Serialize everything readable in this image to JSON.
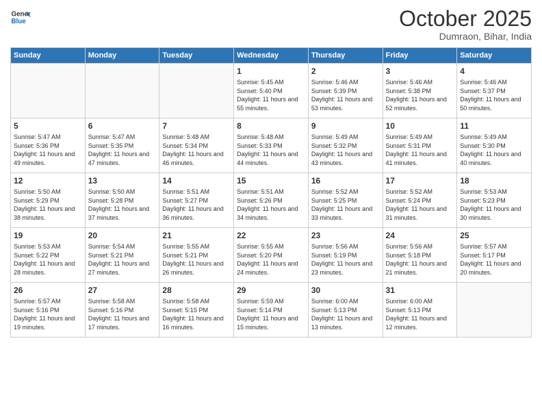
{
  "header": {
    "logo_general": "General",
    "logo_blue": "Blue",
    "month": "October 2025",
    "location": "Dumraon, Bihar, India"
  },
  "days_of_week": [
    "Sunday",
    "Monday",
    "Tuesday",
    "Wednesday",
    "Thursday",
    "Friday",
    "Saturday"
  ],
  "weeks": [
    [
      {
        "day": "",
        "sunrise": "",
        "sunset": "",
        "daylight": ""
      },
      {
        "day": "",
        "sunrise": "",
        "sunset": "",
        "daylight": ""
      },
      {
        "day": "",
        "sunrise": "",
        "sunset": "",
        "daylight": ""
      },
      {
        "day": "1",
        "sunrise": "Sunrise: 5:45 AM",
        "sunset": "Sunset: 5:40 PM",
        "daylight": "Daylight: 11 hours and 55 minutes."
      },
      {
        "day": "2",
        "sunrise": "Sunrise: 5:46 AM",
        "sunset": "Sunset: 5:39 PM",
        "daylight": "Daylight: 11 hours and 53 minutes."
      },
      {
        "day": "3",
        "sunrise": "Sunrise: 5:46 AM",
        "sunset": "Sunset: 5:38 PM",
        "daylight": "Daylight: 11 hours and 52 minutes."
      },
      {
        "day": "4",
        "sunrise": "Sunrise: 5:46 AM",
        "sunset": "Sunset: 5:37 PM",
        "daylight": "Daylight: 11 hours and 50 minutes."
      }
    ],
    [
      {
        "day": "5",
        "sunrise": "Sunrise: 5:47 AM",
        "sunset": "Sunset: 5:36 PM",
        "daylight": "Daylight: 11 hours and 49 minutes."
      },
      {
        "day": "6",
        "sunrise": "Sunrise: 5:47 AM",
        "sunset": "Sunset: 5:35 PM",
        "daylight": "Daylight: 11 hours and 47 minutes."
      },
      {
        "day": "7",
        "sunrise": "Sunrise: 5:48 AM",
        "sunset": "Sunset: 5:34 PM",
        "daylight": "Daylight: 11 hours and 46 minutes."
      },
      {
        "day": "8",
        "sunrise": "Sunrise: 5:48 AM",
        "sunset": "Sunset: 5:33 PM",
        "daylight": "Daylight: 11 hours and 44 minutes."
      },
      {
        "day": "9",
        "sunrise": "Sunrise: 5:49 AM",
        "sunset": "Sunset: 5:32 PM",
        "daylight": "Daylight: 11 hours and 43 minutes."
      },
      {
        "day": "10",
        "sunrise": "Sunrise: 5:49 AM",
        "sunset": "Sunset: 5:31 PM",
        "daylight": "Daylight: 11 hours and 41 minutes."
      },
      {
        "day": "11",
        "sunrise": "Sunrise: 5:49 AM",
        "sunset": "Sunset: 5:30 PM",
        "daylight": "Daylight: 11 hours and 40 minutes."
      }
    ],
    [
      {
        "day": "12",
        "sunrise": "Sunrise: 5:50 AM",
        "sunset": "Sunset: 5:29 PM",
        "daylight": "Daylight: 11 hours and 38 minutes."
      },
      {
        "day": "13",
        "sunrise": "Sunrise: 5:50 AM",
        "sunset": "Sunset: 5:28 PM",
        "daylight": "Daylight: 11 hours and 37 minutes."
      },
      {
        "day": "14",
        "sunrise": "Sunrise: 5:51 AM",
        "sunset": "Sunset: 5:27 PM",
        "daylight": "Daylight: 11 hours and 36 minutes."
      },
      {
        "day": "15",
        "sunrise": "Sunrise: 5:51 AM",
        "sunset": "Sunset: 5:26 PM",
        "daylight": "Daylight: 11 hours and 34 minutes."
      },
      {
        "day": "16",
        "sunrise": "Sunrise: 5:52 AM",
        "sunset": "Sunset: 5:25 PM",
        "daylight": "Daylight: 11 hours and 33 minutes."
      },
      {
        "day": "17",
        "sunrise": "Sunrise: 5:52 AM",
        "sunset": "Sunset: 5:24 PM",
        "daylight": "Daylight: 11 hours and 31 minutes."
      },
      {
        "day": "18",
        "sunrise": "Sunrise: 5:53 AM",
        "sunset": "Sunset: 5:23 PM",
        "daylight": "Daylight: 11 hours and 30 minutes."
      }
    ],
    [
      {
        "day": "19",
        "sunrise": "Sunrise: 5:53 AM",
        "sunset": "Sunset: 5:22 PM",
        "daylight": "Daylight: 11 hours and 28 minutes."
      },
      {
        "day": "20",
        "sunrise": "Sunrise: 5:54 AM",
        "sunset": "Sunset: 5:21 PM",
        "daylight": "Daylight: 11 hours and 27 minutes."
      },
      {
        "day": "21",
        "sunrise": "Sunrise: 5:55 AM",
        "sunset": "Sunset: 5:21 PM",
        "daylight": "Daylight: 11 hours and 26 minutes."
      },
      {
        "day": "22",
        "sunrise": "Sunrise: 5:55 AM",
        "sunset": "Sunset: 5:20 PM",
        "daylight": "Daylight: 11 hours and 24 minutes."
      },
      {
        "day": "23",
        "sunrise": "Sunrise: 5:56 AM",
        "sunset": "Sunset: 5:19 PM",
        "daylight": "Daylight: 11 hours and 23 minutes."
      },
      {
        "day": "24",
        "sunrise": "Sunrise: 5:56 AM",
        "sunset": "Sunset: 5:18 PM",
        "daylight": "Daylight: 11 hours and 21 minutes."
      },
      {
        "day": "25",
        "sunrise": "Sunrise: 5:57 AM",
        "sunset": "Sunset: 5:17 PM",
        "daylight": "Daylight: 11 hours and 20 minutes."
      }
    ],
    [
      {
        "day": "26",
        "sunrise": "Sunrise: 5:57 AM",
        "sunset": "Sunset: 5:16 PM",
        "daylight": "Daylight: 11 hours and 19 minutes."
      },
      {
        "day": "27",
        "sunrise": "Sunrise: 5:58 AM",
        "sunset": "Sunset: 5:16 PM",
        "daylight": "Daylight: 11 hours and 17 minutes."
      },
      {
        "day": "28",
        "sunrise": "Sunrise: 5:58 AM",
        "sunset": "Sunset: 5:15 PM",
        "daylight": "Daylight: 11 hours and 16 minutes."
      },
      {
        "day": "29",
        "sunrise": "Sunrise: 5:59 AM",
        "sunset": "Sunset: 5:14 PM",
        "daylight": "Daylight: 11 hours and 15 minutes."
      },
      {
        "day": "30",
        "sunrise": "Sunrise: 6:00 AM",
        "sunset": "Sunset: 5:13 PM",
        "daylight": "Daylight: 11 hours and 13 minutes."
      },
      {
        "day": "31",
        "sunrise": "Sunrise: 6:00 AM",
        "sunset": "Sunset: 5:13 PM",
        "daylight": "Daylight: 11 hours and 12 minutes."
      },
      {
        "day": "",
        "sunrise": "",
        "sunset": "",
        "daylight": ""
      }
    ]
  ]
}
